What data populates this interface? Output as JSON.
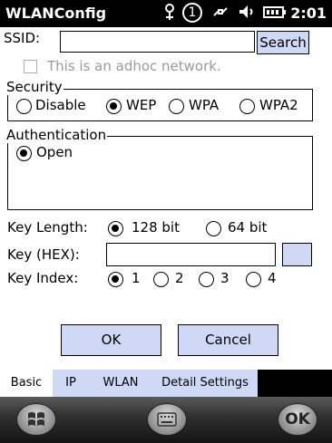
{
  "statusbar": {
    "title": "WLANConfig",
    "time": "2:01",
    "icons": [
      "signal-strength-icon",
      "sim-1-icon",
      "data-sync-icon",
      "volume-icon",
      "battery-icon"
    ],
    "sim_number": "1"
  },
  "form": {
    "ssid_label": "SSID:",
    "ssid_value": "",
    "search_label": "Search",
    "adhoc_label": "This is an adhoc network.",
    "adhoc_checked": false,
    "security": {
      "title": "Security",
      "options": [
        "Disable",
        "WEP",
        "WPA",
        "WPA2"
      ],
      "selected": "WEP"
    },
    "authentication": {
      "title": "Authentication",
      "options": [
        "Open"
      ],
      "selected": "Open"
    },
    "key_length": {
      "label": "Key Length:",
      "options": [
        "128 bit",
        "64 bit"
      ],
      "selected": "128 bit"
    },
    "key_hex": {
      "label": "Key (HEX):",
      "value": ""
    },
    "key_index": {
      "label": "Key Index:",
      "options": [
        "1",
        "2",
        "3",
        "4"
      ],
      "selected": "1"
    },
    "ok_label": "OK",
    "cancel_label": "Cancel"
  },
  "tabs": [
    {
      "label": "Basic",
      "active": true
    },
    {
      "label": "IP",
      "active": false
    },
    {
      "label": "WLAN",
      "active": false
    },
    {
      "label": "Detail Settings",
      "active": false
    }
  ],
  "softkeys": {
    "start_icon": "windows-start-icon",
    "keyboard_icon": "keyboard-icon",
    "ok_label": "OK"
  },
  "colors": {
    "accent": "#cfd8f4",
    "titlebar": "#000000"
  }
}
